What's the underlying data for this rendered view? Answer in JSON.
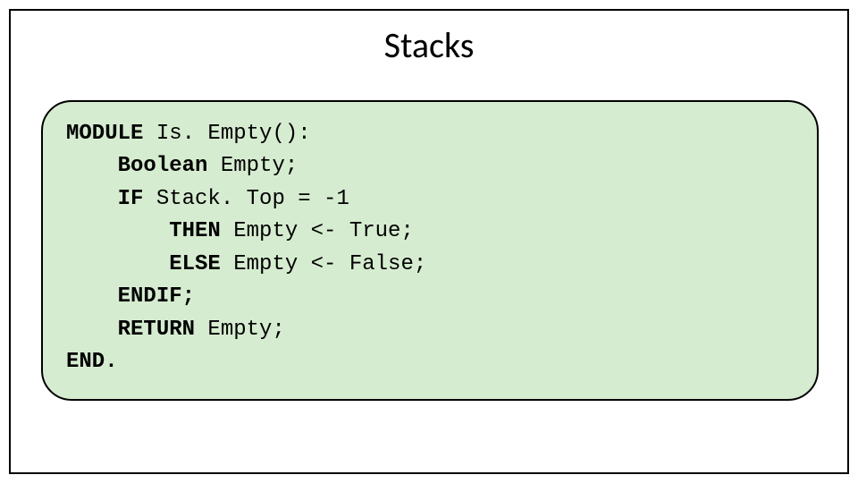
{
  "slide": {
    "title": "Stacks",
    "code": {
      "l1a": "MODULE",
      "l1b": " Is. Empty():",
      "l2a": "    Boolean",
      "l2b": " Empty;",
      "l3a": "    IF",
      "l3b": " Stack. Top = -1",
      "l4a": "        THEN",
      "l4b": " Empty <- True;",
      "l5a": "        ELSE",
      "l5b": " Empty <- False;",
      "l6": "    ENDIF;",
      "l7a": "    RETURN",
      "l7b": " Empty;",
      "l8": "END."
    }
  }
}
